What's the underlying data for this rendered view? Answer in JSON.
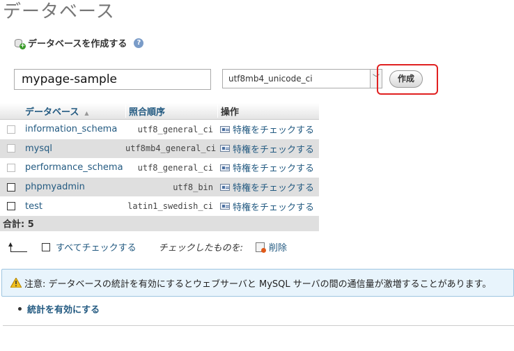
{
  "page_title": "データベース",
  "create_section": {
    "heading": "データベースを作成する",
    "db_name_value": "mypage-sample",
    "collation_selected": "utf8mb4_unicode_ci",
    "create_button_label": "作成"
  },
  "table": {
    "headers": {
      "name": "データベース",
      "collation": "照合順序",
      "action": "操作"
    },
    "rows": [
      {
        "name": "information_schema",
        "collation": "utf8_general_ci",
        "action": "特権をチェックする"
      },
      {
        "name": "mysql",
        "collation": "utf8mb4_general_ci",
        "action": "特権をチェックする"
      },
      {
        "name": "performance_schema",
        "collation": "utf8_general_ci",
        "action": "特権をチェックする"
      },
      {
        "name": "phpmyadmin",
        "collation": "utf8_bin",
        "action": "特権をチェックする"
      },
      {
        "name": "test",
        "collation": "latin1_swedish_ci",
        "action": "特権をチェックする"
      }
    ],
    "total_label": "合計: 5"
  },
  "bulk": {
    "check_all_label": "すべてチェックする",
    "with_selected_label": "チェックしたものを:",
    "delete_label": "削除"
  },
  "notice": {
    "text": "注意: データベースの統計を有効にするとウェブサーバと MySQL サーバの間の通信量が激増することがあります。"
  },
  "enable_stats_label": "統計を有効にする"
}
